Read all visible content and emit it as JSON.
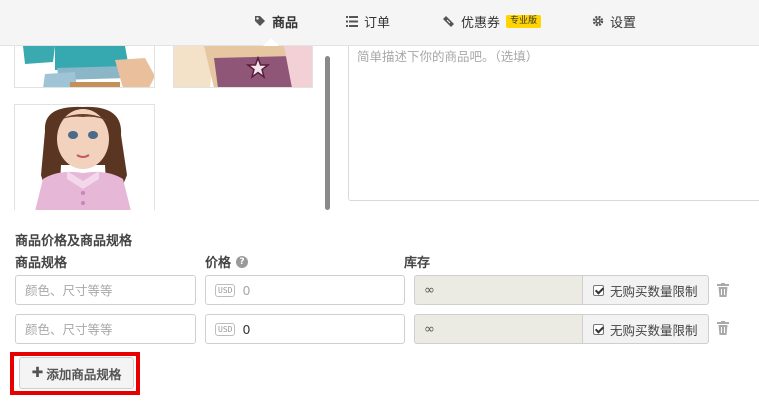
{
  "nav": {
    "items": [
      {
        "label": "商品",
        "icon": "tag-icon",
        "active": true
      },
      {
        "label": "订单",
        "icon": "list-icon",
        "active": false
      },
      {
        "label": "优惠券",
        "icon": "ticket-icon",
        "active": false,
        "badge": "专业版"
      },
      {
        "label": "设置",
        "icon": "gear-icon",
        "active": false
      }
    ]
  },
  "description": {
    "placeholder": "简单描述下你的商品吧。（选填）"
  },
  "pricing": {
    "title": "商品价格及商品规格",
    "columns": {
      "spec": "商品规格",
      "price": "价格",
      "stock": "库存"
    },
    "rows": [
      {
        "spec_placeholder": "颜色、尺寸等等",
        "currency": "USD",
        "price": "0",
        "price_is_placeholder": true,
        "stock": "∞",
        "limit_label": "无购买数量限制",
        "limit_checked": true
      },
      {
        "spec_placeholder": "颜色、尺寸等等",
        "currency": "USD",
        "price": "0",
        "price_is_placeholder": false,
        "stock": "∞",
        "limit_label": "无购买数量限制",
        "limit_checked": true
      }
    ],
    "add_button": "添加商品规格"
  },
  "colors": {
    "highlight": "#e60000",
    "badge": "#ffd400",
    "stock_bg": "#ebebe4"
  }
}
